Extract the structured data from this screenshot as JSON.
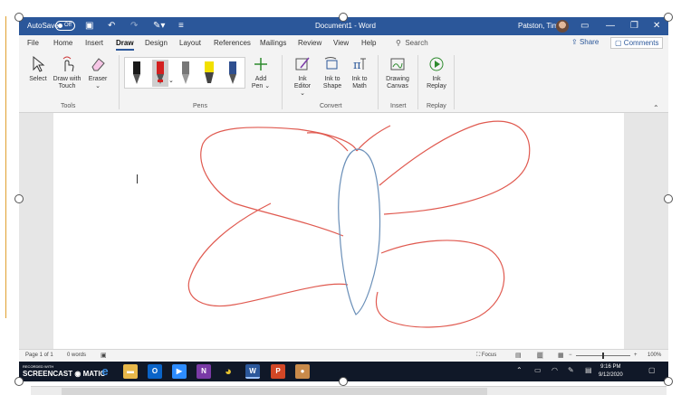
{
  "titlebar": {
    "autosave_label": "AutoSave",
    "autosave_state": "Off",
    "document_title": "Document1 - Word",
    "user_name": "Patston, Tim"
  },
  "menu": {
    "tabs": [
      "File",
      "Home",
      "Insert",
      "Draw",
      "Design",
      "Layout",
      "References",
      "Mailings",
      "Review",
      "View",
      "Help"
    ],
    "active_tab": "Draw",
    "search_label": "Search",
    "share_label": "Share",
    "comments_label": "Comments"
  },
  "ribbon": {
    "tools": {
      "label": "Tools",
      "select": "Select",
      "draw_with_touch_1": "Draw with",
      "draw_with_touch_2": "Touch",
      "eraser": "Eraser"
    },
    "pens": {
      "label": "Pens",
      "add_pen_1": "Add",
      "add_pen_2": "Pen",
      "pen_colors": [
        "#1a1a1a",
        "#d32020",
        "#777777",
        "#f2e000",
        "#2f4f8f"
      ]
    },
    "convert": {
      "label": "Convert",
      "ink_editor_1": "Ink",
      "ink_editor_2": "Editor",
      "ink_to_shape_1": "Ink to",
      "ink_to_shape_2": "Shape",
      "ink_to_math_1": "Ink to",
      "ink_to_math_2": "Math"
    },
    "insert": {
      "label": "Insert",
      "drawing_canvas_1": "Drawing",
      "drawing_canvas_2": "Canvas"
    },
    "replay": {
      "label": "Replay",
      "ink_replay_1": "Ink",
      "ink_replay_2": "Replay"
    }
  },
  "statusbar": {
    "page": "Page 1 of 1",
    "words": "0 words",
    "focus": "Focus",
    "zoom": "100%"
  },
  "taskbar": {
    "recorded_with": "RECORDED WITH",
    "brand": "SCREENCAST",
    "brand2": "MATIC",
    "time": "9:16 PM",
    "date": "9/12/2020"
  },
  "colors": {
    "word_blue": "#2b579a",
    "wing_stroke": "#e05a50",
    "body_stroke": "#6a8fb8"
  }
}
